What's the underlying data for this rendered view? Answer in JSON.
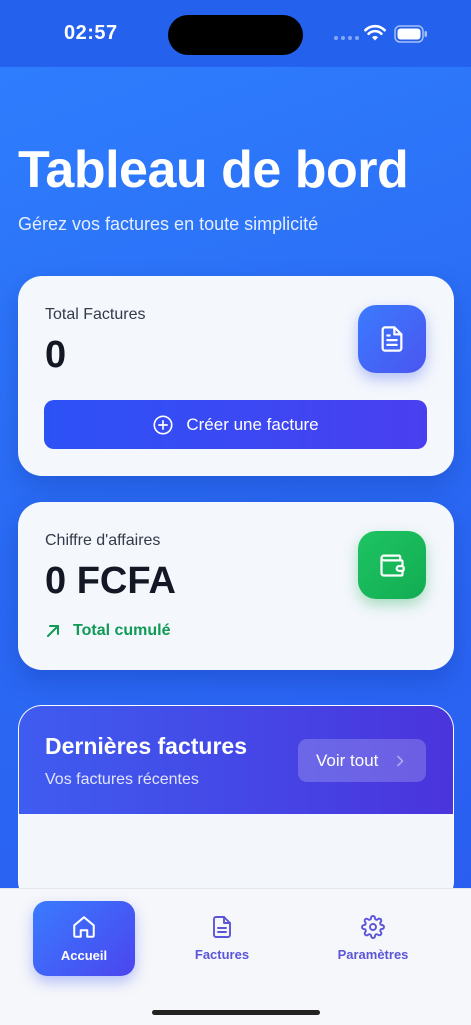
{
  "status_bar": {
    "time": "02:57"
  },
  "header": {
    "title": "Tableau de bord",
    "subtitle": "Gérez vos factures en toute simplicité"
  },
  "total_card": {
    "label": "Total Factures",
    "value": "0",
    "icon": "document-icon",
    "button_label": "Créer une facture"
  },
  "revenue_card": {
    "label": "Chiffre d'affaires",
    "value": "0 FCFA",
    "icon": "wallet-icon",
    "trend_label": "Total cumulé"
  },
  "recent": {
    "title": "Dernières factures",
    "subtitle": "Vos factures récentes",
    "see_all_label": "Voir tout"
  },
  "tab_bar": {
    "items": [
      {
        "label": "Accueil",
        "icon": "home-icon",
        "active": true
      },
      {
        "label": "Factures",
        "icon": "document-icon",
        "active": false
      },
      {
        "label": "Paramètres",
        "icon": "gear-icon",
        "active": false
      }
    ]
  },
  "colors": {
    "background": "#2a6bf4",
    "accent": "#4a45ee",
    "success": "#12ac52"
  }
}
